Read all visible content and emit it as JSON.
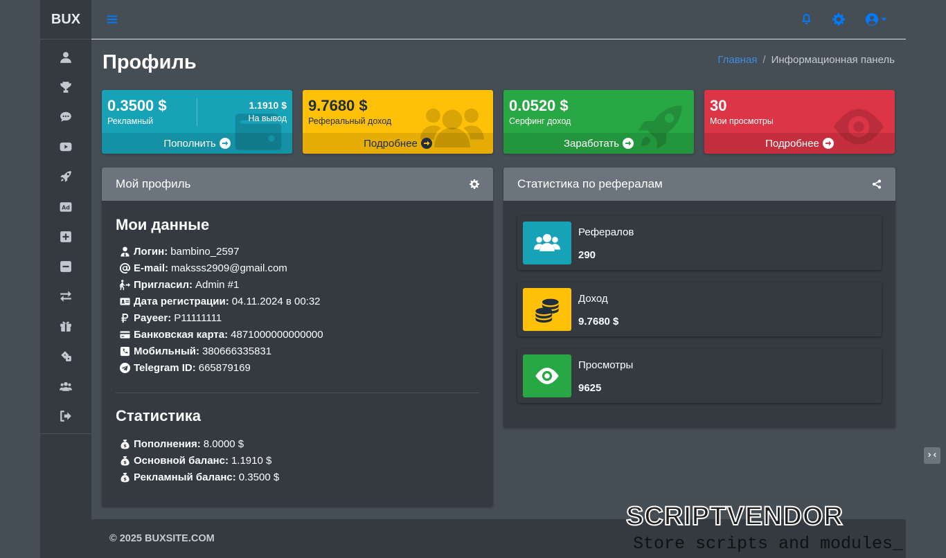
{
  "brand": "BUX",
  "page_title": "Профиль",
  "breadcrumb": {
    "home": "Главная",
    "sep": "/",
    "current": "Информационная панель"
  },
  "boxes": [
    {
      "value": "0.3500 $",
      "label": "Рекламный",
      "value2": "1.1910 $",
      "label2": "На вывод",
      "action": "Пополнить",
      "color": "#17a2b8"
    },
    {
      "value": "9.7680 $",
      "label": "Реферальный доход",
      "action": "Подробнее",
      "color": "#ffc107"
    },
    {
      "value": "0.0520 $",
      "label": "Серфинг доход",
      "action": "Заработать",
      "color": "#28a745"
    },
    {
      "value": "30",
      "label": "Мои просмотры",
      "action": "Подробнее",
      "color": "#dc3545"
    }
  ],
  "profile": {
    "header": "Мой профиль",
    "data_title": "Мои данные",
    "rows": [
      {
        "icon": "user-tie-icon",
        "label": "Логин:",
        "value": "bambino_2597"
      },
      {
        "icon": "at-icon",
        "label": "E-mail:",
        "value": "maksss2909@gmail.com"
      },
      {
        "icon": "person-arrow-icon",
        "label": "Пригласил:",
        "value": "Admin #1"
      },
      {
        "icon": "id-card-icon",
        "label": "Дата регистрации:",
        "value": "04.11.2024 в 00:32"
      },
      {
        "icon": "ruble-icon",
        "label": "Payeer:",
        "value": "P11111111"
      },
      {
        "icon": "credit-card-icon",
        "label": "Банковская карта:",
        "value": "4871000000000000"
      },
      {
        "icon": "phone-square-icon",
        "label": "Мобильный:",
        "value": "380666335831"
      },
      {
        "icon": "telegram-icon",
        "label": "Telegram ID:",
        "value": "665879169"
      }
    ],
    "stats_title": "Статистика",
    "stats": [
      {
        "icon": "money-bag-icon",
        "label": "Пополнения:",
        "value": "8.0000 $"
      },
      {
        "icon": "money-bag-icon",
        "label": "Основной баланс:",
        "value": "1.1910 $"
      },
      {
        "icon": "money-bag-icon",
        "label": "Рекламный баланс:",
        "value": "0.3500 $"
      }
    ]
  },
  "referrals": {
    "header": "Статистика по рефералам",
    "items": [
      {
        "icon": "users-icon",
        "title": "Рефералов",
        "value": "290",
        "color": "#17a2b8"
      },
      {
        "icon": "coins-icon",
        "title": "Доход",
        "value": "9.7680 $",
        "color": "#ffc107"
      },
      {
        "icon": "eye-icon",
        "title": "Просмотры",
        "value": "9625",
        "color": "#28a745"
      }
    ]
  },
  "footer": {
    "copyright": "© 2025 BUXSITE.COM"
  },
  "sidebar_icons": [
    "user-icon",
    "trophy-icon",
    "comment-icon",
    "youtube-icon",
    "rocket-icon",
    "ad-icon",
    "plus-square-icon",
    "minus-square-icon",
    "exchange-icon",
    "gift-icon",
    "dice-icon",
    "users-icon",
    "sign-out-icon"
  ]
}
